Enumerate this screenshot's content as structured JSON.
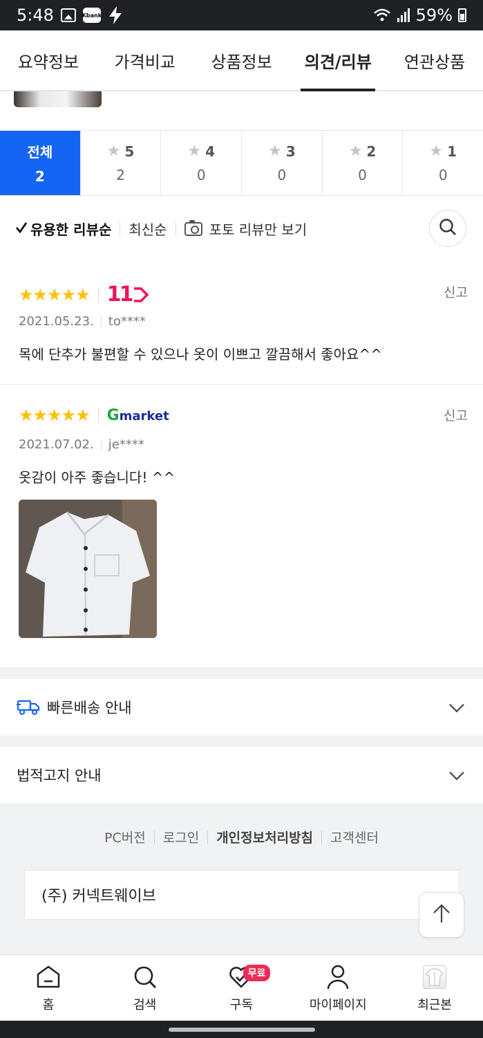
{
  "status_bar": {
    "time": "5:48",
    "kbank": "Kbank",
    "battery": "59%"
  },
  "tabs": [
    {
      "label": "요약정보"
    },
    {
      "label": "가격비교"
    },
    {
      "label": "상품정보"
    },
    {
      "label": "의견/리뷰",
      "active": true
    },
    {
      "label": "연관상품"
    }
  ],
  "rating_filter": [
    {
      "label": "전체",
      "count": "2",
      "active": true
    },
    {
      "label": "5",
      "count": "2"
    },
    {
      "label": "4",
      "count": "0"
    },
    {
      "label": "3",
      "count": "0"
    },
    {
      "label": "2",
      "count": "0"
    },
    {
      "label": "1",
      "count": "0"
    }
  ],
  "sort": {
    "helpful": "유용한 리뷰순",
    "latest": "최신순",
    "photo_only": "포토 리뷰만 보기"
  },
  "reviews": [
    {
      "stars": "★★★★★",
      "rating": 5,
      "store": "11",
      "date": "2021.05.23.",
      "user": "to****",
      "text": "목에 단추가 불편할 수 있으나 옷이 이쁘고 깔끔해서 좋아요^^",
      "report": "신고"
    },
    {
      "stars": "★★★★★",
      "rating": 5,
      "store_g": "G",
      "store_rest": "market",
      "date": "2021.07.02.",
      "user": "je****",
      "text": "옷감이 아주 좋습니다! ^^",
      "report": "신고",
      "has_photo": true
    }
  ],
  "info": {
    "fast_delivery": "빠른배송 안내",
    "legal_notice": "법적고지 안내"
  },
  "footer": {
    "links": [
      "PC버전",
      "로그인",
      "개인정보처리방침",
      "고객센터"
    ],
    "company": "(주) 커넥트웨이브"
  },
  "bottom_nav": [
    {
      "label": "홈",
      "icon": "home-icon"
    },
    {
      "label": "검색",
      "icon": "search-icon"
    },
    {
      "label": "구독",
      "icon": "heart-check-icon",
      "badge": "무료"
    },
    {
      "label": "마이페이지",
      "icon": "person-icon"
    },
    {
      "label": "최근본",
      "icon": "recent-thumbnail"
    }
  ],
  "colors": {
    "accent": "#1565f5",
    "star": "#ffc107",
    "badge": "#ef2a55"
  }
}
